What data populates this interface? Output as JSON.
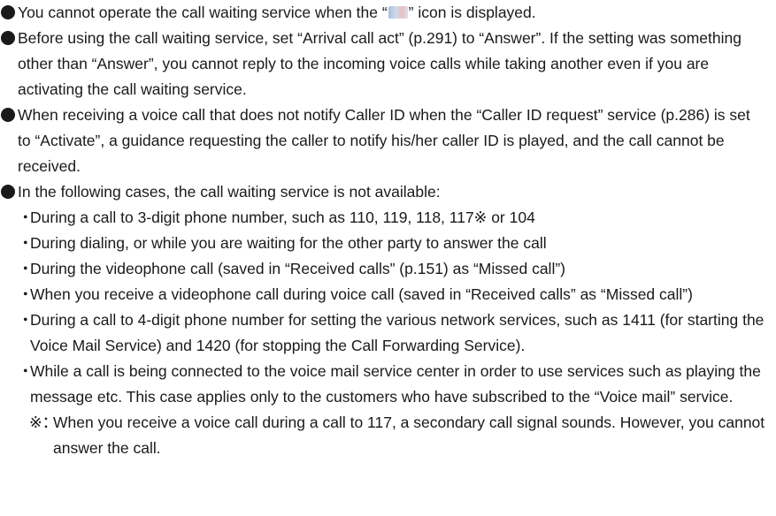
{
  "bullets": {
    "b1": {
      "before_icon": "You cannot operate the call waiting service when the “",
      "icon": "call-waiting-unavailable-icon",
      "after_icon": "” icon is displayed."
    },
    "b2": "Before using the call waiting service, set “Arrival call act” (p.291) to “Answer”. If the setting was something other than “Answer”, you cannot reply to the incoming voice calls while taking another even if you are activating the call waiting service.",
    "b3": "When receiving a voice call that does not notify Caller ID when the “Caller ID request” service (p.286) is set to “Activate”, a guidance requesting the caller to notify his/her caller ID is played, and the call cannot be received.",
    "b4": "In the following cases, the call waiting service is not available:"
  },
  "cases": [
    "During a call to 3-digit phone number, such as 110, 119, 118, 117※ or 104",
    "During dialing, or while you are waiting for the other party to answer the call",
    "During the videophone call (saved in “Received calls” (p.151) as “Missed call”)",
    "When you receive a videophone call during voice call (saved in “Received calls” as “Missed call”)",
    "During a call to 4-digit phone number for setting the various network services, such as 1411 (for starting the Voice Mail Service) and 1420 (for stopping the Call Forwarding Service).",
    "While a call is being connected to the voice mail service center in order to use services such as playing the message etc. This case applies only to the customers who have subscribed to the “Voice mail” service."
  ],
  "case_marker": "・",
  "note": {
    "mark": "※：",
    "text": "When you receive a voice call during a call to 117, a secondary call signal sounds. However, you cannot answer the call."
  }
}
